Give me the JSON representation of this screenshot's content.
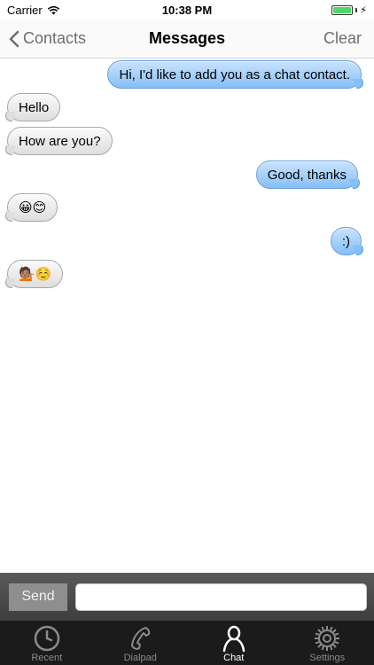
{
  "status_bar": {
    "carrier": "Carrier",
    "time": "10:38 PM"
  },
  "nav": {
    "back_label": "Contacts",
    "title": "Messages",
    "clear_label": "Clear"
  },
  "messages": [
    {
      "text": "Hi, I'd like to add you as a chat contact.",
      "direction": "outgoing"
    },
    {
      "text": "Hello",
      "direction": "incoming"
    },
    {
      "text": "How are you?",
      "direction": "incoming"
    },
    {
      "text": "Good, thanks",
      "direction": "outgoing"
    },
    {
      "text": "😀😊",
      "direction": "incoming"
    },
    {
      "text": ":)",
      "direction": "outgoing"
    },
    {
      "text": "💁🏽☺️",
      "direction": "incoming"
    }
  ],
  "input_bar": {
    "send_label": "Send",
    "input_value": "",
    "input_placeholder": ""
  },
  "tabs": [
    {
      "label": "Recent",
      "icon": "clock-icon",
      "active": false
    },
    {
      "label": "Dialpad",
      "icon": "phone-handset-icon",
      "active": false
    },
    {
      "label": "Chat",
      "icon": "person-icon",
      "active": true
    },
    {
      "label": "Settings",
      "icon": "gear-icon",
      "active": false
    }
  ],
  "colors": {
    "incoming_bubble": "#dedede",
    "outgoing_bubble": "#85bff7",
    "battery": "#4cd964",
    "tab_bar": "#1b1b1b"
  }
}
